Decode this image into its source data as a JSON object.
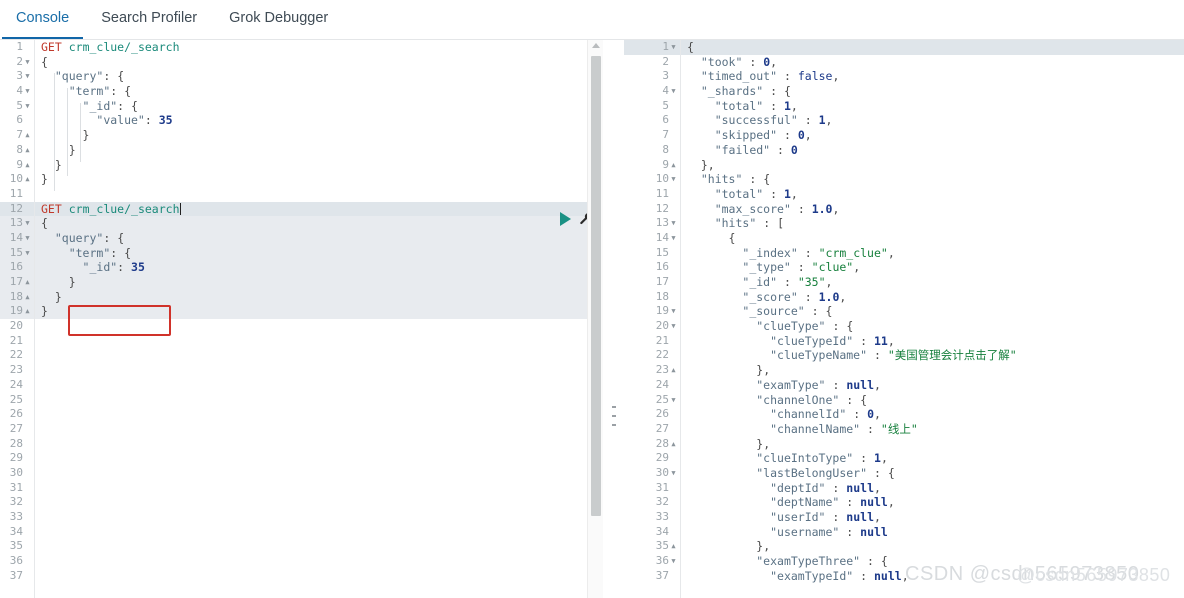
{
  "tabs": [
    {
      "label": "Console",
      "active": true
    },
    {
      "label": "Search Profiler",
      "active": false
    },
    {
      "label": "Grok Debugger",
      "active": false
    }
  ],
  "icons": {
    "play": "play-icon",
    "wrench": "wrench-icon",
    "scroll_up": "scroll-up-arrow-icon",
    "splitter": "splitter-grip-icon"
  },
  "colors": {
    "accent": "#1166a8",
    "play_green": "#1a9184",
    "annotation_red": "#d0322a",
    "active_line": "#dfe5ea",
    "selection": "#e8ebef",
    "string_green": "#17803d",
    "number_blue": "#1d3a8a",
    "method_red": "#c0392b",
    "url_teal": "#1a8a7a"
  },
  "request_editor": {
    "name": "console-request-editor",
    "first_line_number": 1,
    "last_line_number": 37,
    "active_line": 12,
    "selected_lines": [
      13,
      14,
      15,
      16,
      17,
      18,
      19
    ],
    "fold_markers": {
      "2": "down",
      "3": "down",
      "4": "down",
      "5": "down",
      "7": "up",
      "8": "up",
      "9": "up",
      "10": "up",
      "13": "down",
      "14": "down",
      "15": "down",
      "17": "up",
      "18": "up",
      "19": "up"
    },
    "lines": [
      {
        "n": 1,
        "text": "GET crm_clue/_search",
        "kind": "request-line"
      },
      {
        "n": 2,
        "text": "{"
      },
      {
        "n": 3,
        "text": "  \"query\": {"
      },
      {
        "n": 4,
        "text": "    \"term\": {"
      },
      {
        "n": 5,
        "text": "      \"_id\": {"
      },
      {
        "n": 6,
        "text": "        \"value\": 35"
      },
      {
        "n": 7,
        "text": "      }"
      },
      {
        "n": 8,
        "text": "    }"
      },
      {
        "n": 9,
        "text": "  }"
      },
      {
        "n": 10,
        "text": "}"
      },
      {
        "n": 11,
        "text": ""
      },
      {
        "n": 12,
        "text": "GET crm_clue/_search",
        "kind": "request-line"
      },
      {
        "n": 13,
        "text": "{"
      },
      {
        "n": 14,
        "text": "  \"query\": {"
      },
      {
        "n": 15,
        "text": "    \"term\": {"
      },
      {
        "n": 16,
        "text": "      \"_id\": 35"
      },
      {
        "n": 17,
        "text": "    }"
      },
      {
        "n": 18,
        "text": "  }"
      },
      {
        "n": 19,
        "text": "}"
      },
      {
        "n": 20,
        "text": ""
      },
      {
        "n": 21,
        "text": ""
      },
      {
        "n": 22,
        "text": ""
      },
      {
        "n": 23,
        "text": ""
      },
      {
        "n": 24,
        "text": ""
      },
      {
        "n": 25,
        "text": ""
      },
      {
        "n": 26,
        "text": ""
      },
      {
        "n": 27,
        "text": ""
      },
      {
        "n": 28,
        "text": ""
      },
      {
        "n": 29,
        "text": ""
      },
      {
        "n": 30,
        "text": ""
      },
      {
        "n": 31,
        "text": ""
      },
      {
        "n": 32,
        "text": ""
      },
      {
        "n": 33,
        "text": ""
      },
      {
        "n": 34,
        "text": ""
      },
      {
        "n": 35,
        "text": ""
      },
      {
        "n": 36,
        "text": ""
      },
      {
        "n": 37,
        "text": ""
      }
    ]
  },
  "response_editor": {
    "name": "console-response-editor",
    "first_line_number": 1,
    "last_line_number": 37,
    "active_line": 1,
    "fold_markers": {
      "1": "down",
      "4": "down",
      "9": "up",
      "10": "down",
      "13": "down",
      "14": "down",
      "19": "down",
      "20": "down",
      "23": "up",
      "25": "down",
      "28": "up",
      "30": "down",
      "35": "up",
      "36": "down"
    },
    "lines": [
      {
        "n": 1,
        "text": "{"
      },
      {
        "n": 2,
        "text": "  \"took\" : 0,"
      },
      {
        "n": 3,
        "text": "  \"timed_out\" : false,"
      },
      {
        "n": 4,
        "text": "  \"_shards\" : {"
      },
      {
        "n": 5,
        "text": "    \"total\" : 1,"
      },
      {
        "n": 6,
        "text": "    \"successful\" : 1,"
      },
      {
        "n": 7,
        "text": "    \"skipped\" : 0,"
      },
      {
        "n": 8,
        "text": "    \"failed\" : 0"
      },
      {
        "n": 9,
        "text": "  },"
      },
      {
        "n": 10,
        "text": "  \"hits\" : {"
      },
      {
        "n": 11,
        "text": "    \"total\" : 1,"
      },
      {
        "n": 12,
        "text": "    \"max_score\" : 1.0,"
      },
      {
        "n": 13,
        "text": "    \"hits\" : ["
      },
      {
        "n": 14,
        "text": "      {"
      },
      {
        "n": 15,
        "text": "        \"_index\" : \"crm_clue\","
      },
      {
        "n": 16,
        "text": "        \"_type\" : \"clue\","
      },
      {
        "n": 17,
        "text": "        \"_id\" : \"35\","
      },
      {
        "n": 18,
        "text": "        \"_score\" : 1.0,"
      },
      {
        "n": 19,
        "text": "        \"_source\" : {"
      },
      {
        "n": 20,
        "text": "          \"clueType\" : {"
      },
      {
        "n": 21,
        "text": "            \"clueTypeId\" : 11,"
      },
      {
        "n": 22,
        "text": "            \"clueTypeName\" : \"美国管理会计点击了解\""
      },
      {
        "n": 23,
        "text": "          },"
      },
      {
        "n": 24,
        "text": "          \"examType\" : null,"
      },
      {
        "n": 25,
        "text": "          \"channelOne\" : {"
      },
      {
        "n": 26,
        "text": "            \"channelId\" : 0,"
      },
      {
        "n": 27,
        "text": "            \"channelName\" : \"线上\""
      },
      {
        "n": 28,
        "text": "          },"
      },
      {
        "n": 29,
        "text": "          \"clueIntoType\" : 1,"
      },
      {
        "n": 30,
        "text": "          \"lastBelongUser\" : {"
      },
      {
        "n": 31,
        "text": "            \"deptId\" : null,"
      },
      {
        "n": 32,
        "text": "            \"deptName\" : null,"
      },
      {
        "n": 33,
        "text": "            \"userId\" : null,"
      },
      {
        "n": 34,
        "text": "            \"username\" : null"
      },
      {
        "n": 35,
        "text": "          },"
      },
      {
        "n": 36,
        "text": "          \"examTypeThree\" : {"
      },
      {
        "n": 37,
        "text": "            \"examTypeId\" : null,"
      }
    ]
  },
  "annotations": [
    {
      "name": "redbox-request-id",
      "target_line": 16,
      "pane": "request"
    },
    {
      "name": "redbox-response-id",
      "target_line": 17,
      "pane": "response"
    }
  ],
  "watermark": {
    "text": "CSDN @csdn565973850",
    "overlap": "@csdn565973850"
  }
}
